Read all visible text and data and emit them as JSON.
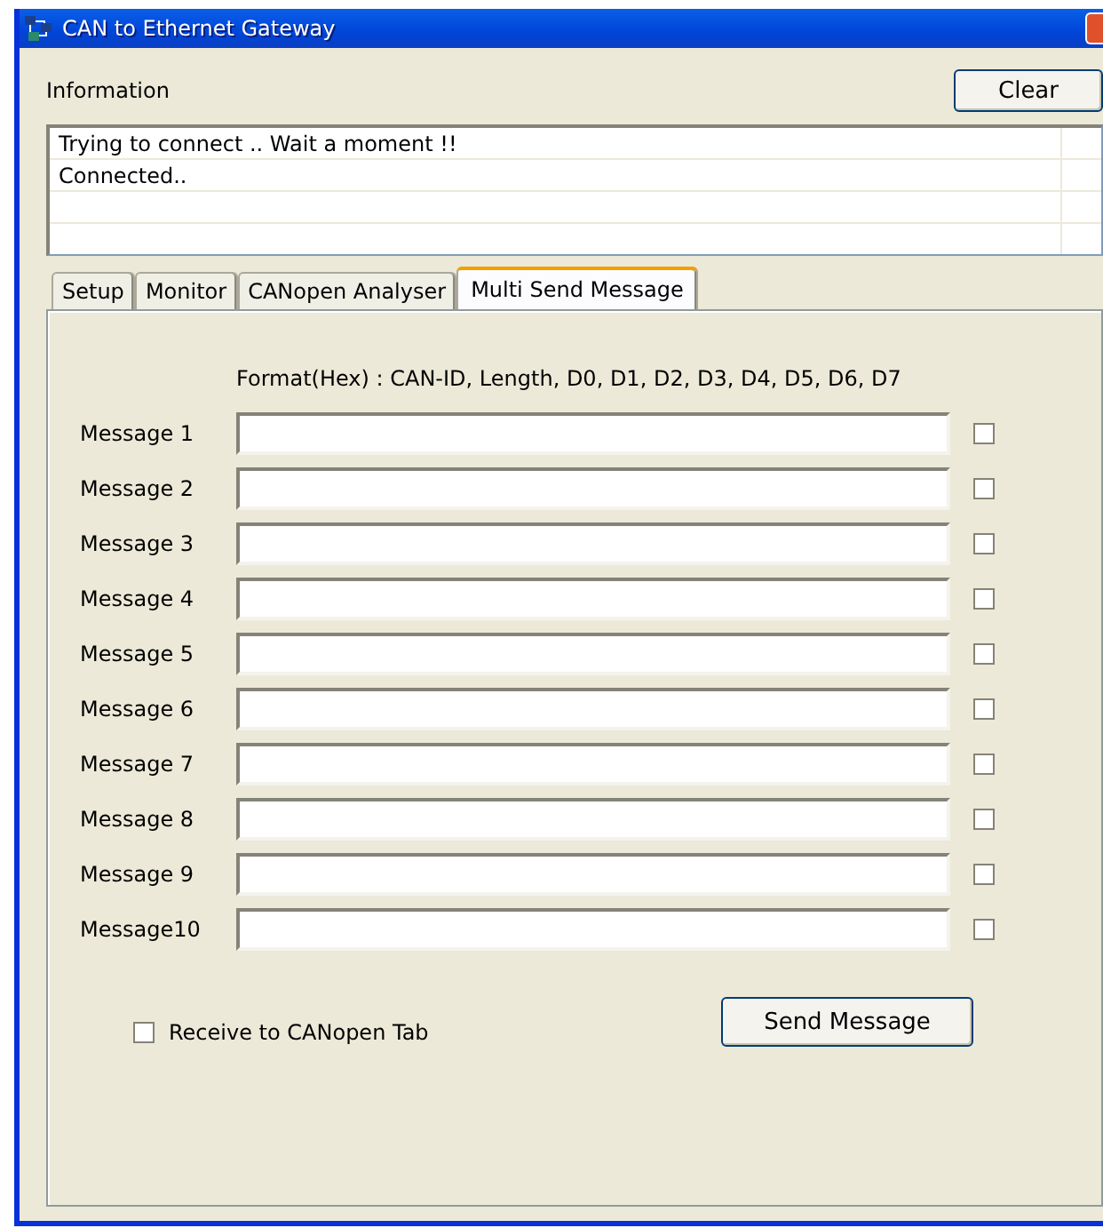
{
  "window": {
    "title": "CAN to Ethernet Gateway"
  },
  "information": {
    "label": "Information",
    "clear_button": "Clear",
    "lines": [
      "Trying to connect .. Wait a moment !!",
      "Connected.."
    ]
  },
  "tabs": [
    {
      "label": "Setup",
      "selected": false
    },
    {
      "label": "Monitor",
      "selected": false
    },
    {
      "label": "CANopen Analyser",
      "selected": false
    },
    {
      "label": "Multi Send Message",
      "selected": true
    }
  ],
  "format_hint": "Format(Hex) : CAN-ID, Length, D0, D1, D2, D3, D4, D5, D6, D7",
  "messages": [
    {
      "label": "Message 1",
      "checked": false
    },
    {
      "label": "Message 2",
      "checked": false
    },
    {
      "label": "Message 3",
      "checked": false
    },
    {
      "label": "Message 4",
      "checked": false
    },
    {
      "label": "Message 5",
      "checked": false
    },
    {
      "label": "Message 6",
      "checked": false
    },
    {
      "label": "Message 7",
      "checked": false
    },
    {
      "label": "Message 8",
      "checked": false
    },
    {
      "label": "Message 9",
      "checked": false
    },
    {
      "label": "Message10",
      "checked": false
    }
  ],
  "receive_option": {
    "label": "Receive to CANopen Tab",
    "checked": false
  },
  "send_button": "Send Message"
}
